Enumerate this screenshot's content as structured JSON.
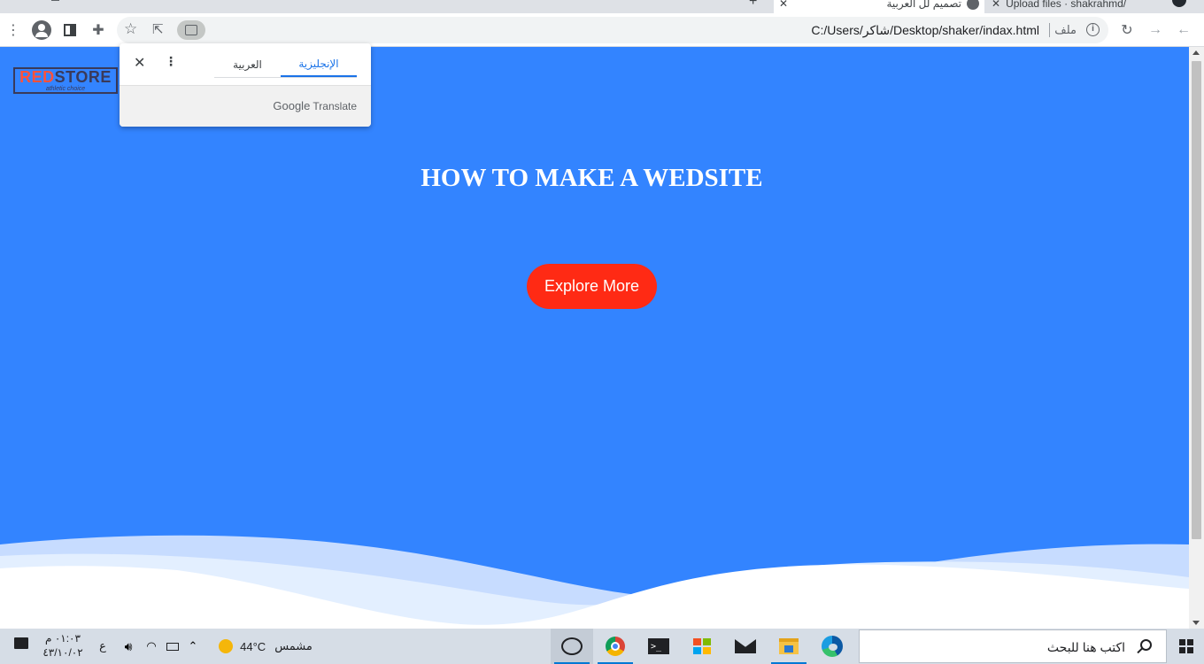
{
  "browser": {
    "tabs": [
      {
        "label": "تصميم لل العربية",
        "active": true
      },
      {
        "label": "Upload files · shakrahmd/",
        "active": false
      }
    ],
    "address": {
      "url": "C:/Users/شاكر/Desktop/shaker/indax.html",
      "scheme_label": "ملف"
    }
  },
  "translate_popup": {
    "tab_source": "الإنجليزية",
    "tab_target": "العربية",
    "brand_google": "Google",
    "brand_translate": "Translate"
  },
  "page": {
    "logo_red": "RED",
    "logo_rest": "STORE",
    "logo_tagline": "athletic choice",
    "hero_title": "HOW TO MAKE A WEDSITE",
    "hero_button": "Explore More",
    "colors": {
      "background": "#3384ff",
      "button": "#ff2a14",
      "wave_light": "#dbe9ff"
    }
  },
  "taskbar": {
    "search_placeholder": "اكتب هنا للبحث",
    "weather_temp": "44°C",
    "weather_label": "مشمس",
    "keyboard_lang": "ع",
    "clock_time": "٠١:٠٣ م",
    "clock_date": "٤٣/١٠/٠٢",
    "apps": [
      "photos-app-icon",
      "chrome-icon",
      "terminal-icon",
      "store-icon",
      "mail-icon",
      "file-explorer-icon",
      "edge-icon"
    ]
  }
}
